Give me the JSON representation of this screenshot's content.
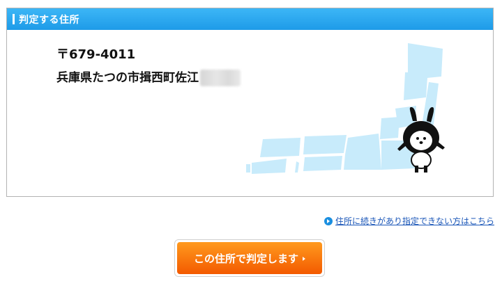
{
  "panel": {
    "title": "判定する住所",
    "postal_code": "〒679-4011",
    "address": "兵庫県たつの市揖西町佐江"
  },
  "help_link": {
    "label": "住所に続きがあり指定できない方はこちら"
  },
  "submit_button": {
    "label": "この住所で判定します"
  },
  "colors": {
    "header": "#1e9be8",
    "map": "#c8ebfb",
    "button": "#f35a00",
    "link": "#1a56b8"
  },
  "icons": {
    "help": "play-circle-icon",
    "button_arrow": "triangle-right-icon",
    "map": "japan-map-icon",
    "mascot": "rabbit-mascot"
  }
}
